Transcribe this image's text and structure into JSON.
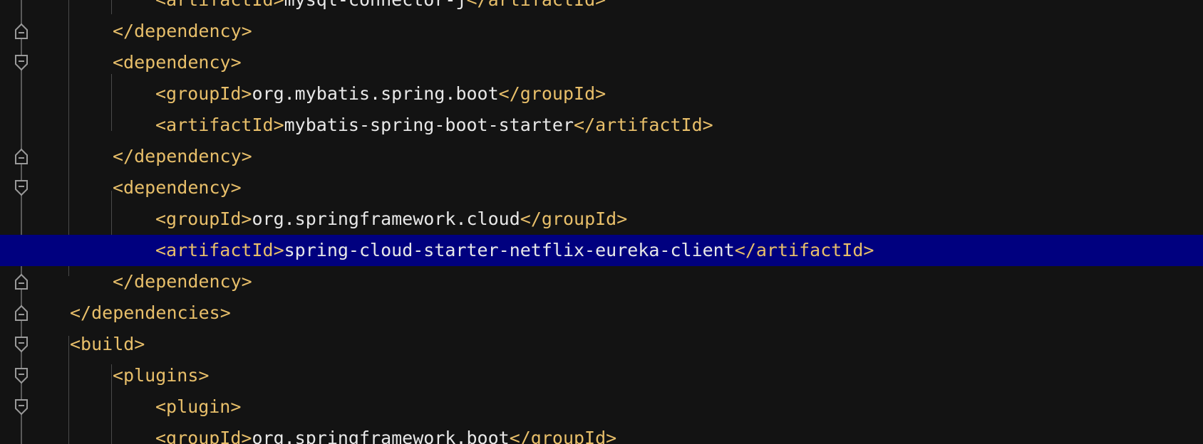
{
  "editor": {
    "language": "xml",
    "lines": [
      {
        "indent": 3,
        "open": "<artifactId>",
        "text": "mysql-connector-j",
        "close": "</artifactId>",
        "fold": "none",
        "highlighted": false
      },
      {
        "indent": 2,
        "open": "</dependency>",
        "text": "",
        "close": "",
        "fold": "end",
        "highlighted": false
      },
      {
        "indent": 2,
        "open": "<dependency>",
        "text": "",
        "close": "",
        "fold": "start",
        "highlighted": false
      },
      {
        "indent": 3,
        "open": "<groupId>",
        "text": "org.mybatis.spring.boot",
        "close": "</groupId>",
        "fold": "none",
        "highlighted": false
      },
      {
        "indent": 3,
        "open": "<artifactId>",
        "text": "mybatis-spring-boot-starter",
        "close": "</artifactId>",
        "fold": "none",
        "highlighted": false
      },
      {
        "indent": 2,
        "open": "</dependency>",
        "text": "",
        "close": "",
        "fold": "end",
        "highlighted": false
      },
      {
        "indent": 2,
        "open": "<dependency>",
        "text": "",
        "close": "",
        "fold": "start",
        "highlighted": false
      },
      {
        "indent": 3,
        "open": "<groupId>",
        "text": "org.springframework.cloud",
        "close": "</groupId>",
        "fold": "none",
        "highlighted": false
      },
      {
        "indent": 3,
        "open": "<artifactId>",
        "text": "spring-cloud-starter-netflix-eureka-client",
        "close": "</artifactId>",
        "fold": "none",
        "highlighted": true
      },
      {
        "indent": 2,
        "open": "</dependency>",
        "text": "",
        "close": "",
        "fold": "end",
        "highlighted": false
      },
      {
        "indent": 1,
        "open": "</dependencies>",
        "text": "",
        "close": "",
        "fold": "end",
        "highlighted": false
      },
      {
        "indent": 1,
        "open": "<build>",
        "text": "",
        "close": "",
        "fold": "start",
        "highlighted": false
      },
      {
        "indent": 2,
        "open": "<plugins>",
        "text": "",
        "close": "",
        "fold": "start",
        "highlighted": false
      },
      {
        "indent": 3,
        "open": "<plugin>",
        "text": "",
        "close": "",
        "fold": "start",
        "highlighted": false
      },
      {
        "indent": 3,
        "open": "<groupId>",
        "text": "org.springframework.boot",
        "close": "</groupId>",
        "fold": "none",
        "highlighted": false
      }
    ],
    "colors": {
      "background": "#131313",
      "tag": "#e8bf6a",
      "text": "#e8e8e8",
      "highlight": "#00007f",
      "gutter": "#5a5a5a"
    }
  }
}
